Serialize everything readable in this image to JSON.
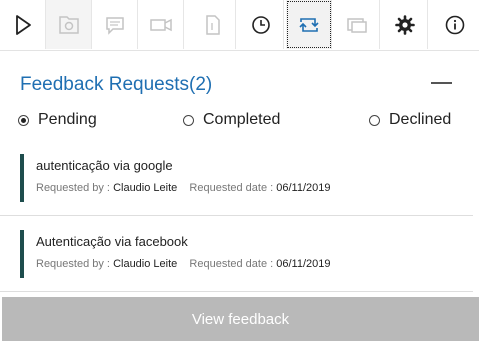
{
  "toolbar": {
    "buttons": [
      {
        "icon": "play-icon",
        "state": "enabled"
      },
      {
        "icon": "camera-folder-icon",
        "state": "disabled"
      },
      {
        "icon": "comment-icon",
        "state": "disabled"
      },
      {
        "icon": "video-camera-icon",
        "state": "disabled"
      },
      {
        "icon": "document-icon",
        "state": "disabled"
      },
      {
        "icon": "clock-icon",
        "state": "enabled"
      },
      {
        "icon": "crop-rotate-icon",
        "state": "active"
      },
      {
        "icon": "screen-share-icon",
        "state": "disabled"
      },
      {
        "icon": "gear-icon",
        "state": "enabled"
      },
      {
        "icon": "info-icon",
        "state": "enabled"
      }
    ]
  },
  "panel": {
    "title": "Feedback Requests",
    "count": "(2)"
  },
  "filters": [
    {
      "label": "Pending",
      "selected": true
    },
    {
      "label": "Completed",
      "selected": false
    },
    {
      "label": "Declined",
      "selected": false
    }
  ],
  "requests": [
    {
      "title": "autenticação via google",
      "requested_by_label": "Requested by :",
      "requested_by": "Claudio Leite",
      "requested_date_label": "Requested date :",
      "requested_date": "06/11/2019"
    },
    {
      "title": "Autenticação via facebook",
      "requested_by_label": "Requested by :",
      "requested_by": "Claudio Leite",
      "requested_date_label": "Requested date :",
      "requested_date": "06/11/2019"
    }
  ],
  "actions": {
    "view_feedback": "View feedback"
  },
  "colors": {
    "accent": "#1f6fb2",
    "card_bar": "#1e4d4d",
    "disabled_button": "#b9b9b9"
  }
}
